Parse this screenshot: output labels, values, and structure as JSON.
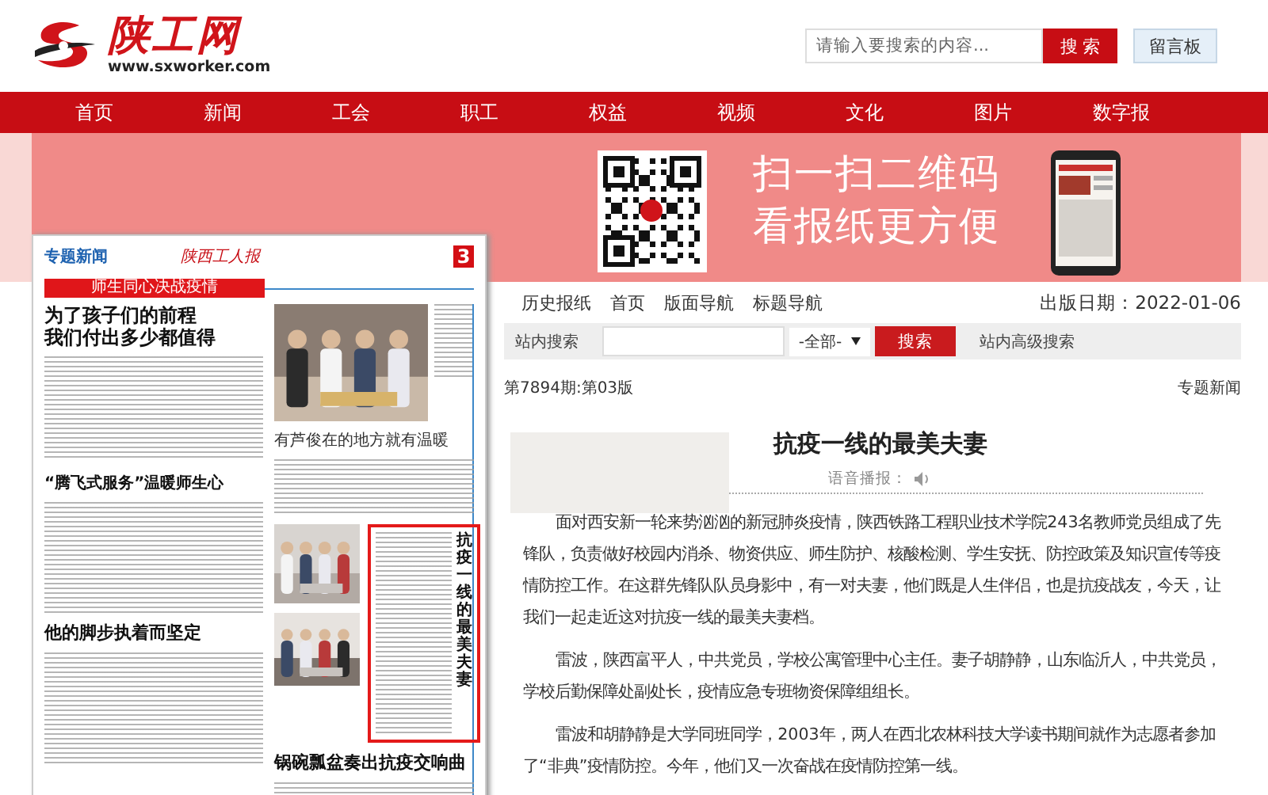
{
  "header": {
    "logo": {
      "name": "陕工网",
      "url": "www.sxworker.com"
    },
    "search": {
      "placeholder": "请输入要搜索的内容...",
      "button": "搜 索"
    },
    "guestbook": "留言板"
  },
  "nav": [
    {
      "label": "首页"
    },
    {
      "label": "新闻"
    },
    {
      "label": "工会"
    },
    {
      "label": "职工"
    },
    {
      "label": "权益"
    },
    {
      "label": "视频"
    },
    {
      "label": "文化"
    },
    {
      "label": "图片"
    },
    {
      "label": "数字报"
    }
  ],
  "banner": {
    "lines": [
      "扫一扫二维码",
      "看报纸更方便"
    ]
  },
  "newspaper_page": {
    "section": "专题新闻",
    "masthead": "陕西工人报",
    "page_number": "3",
    "feature_label": "师生同心决战疫情",
    "lead": {
      "lines": [
        "为了孩子们的前程",
        "我们付出多少都值得"
      ]
    },
    "left_stories": [
      {
        "title": "“腾飞式服务”温暖师生心"
      },
      {
        "title": "他的脚步执着而坚定"
      }
    ],
    "right_story": {
      "title": "有芦俊在的地方就有温暖"
    },
    "boxed_story": {
      "title": "抗疫一线的最美夫妻"
    },
    "bottom_story": {
      "title": "锅碗瓢盆奏出抗疫交响曲"
    }
  },
  "article": {
    "toolbar": {
      "links": [
        "历史报纸",
        "首页",
        "版面导航",
        "标题导航"
      ],
      "date": "出版日期：2022-01-06"
    },
    "search": {
      "label": "站内搜索",
      "select": "-全部-",
      "button": "搜索",
      "advanced": "站内高级搜索"
    },
    "issue": "第7894期:第03版",
    "section": "专题新闻",
    "title": "抗疫一线的最美夫妻",
    "audio_label": "语音播报：",
    "paragraphs": [
      "面对西安新一轮来势汹汹的新冠肺炎疫情，陕西铁路工程职业技术学院243名教师党员组成了先锋队，负责做好校园内消杀、物资供应、师生防护、核酸检测、学生安抚、防控政策及知识宣传等疫情防控工作。在这群先锋队队员身影中，有一对夫妻，他们既是人生伴侣，也是抗疫战友，今天，让我们一起走近这对抗疫一线的最美夫妻档。",
      "雷波，陕西富平人，中共党员，学校公寓管理中心主任。妻子胡静静，山东临沂人，中共党员，学校后勤保障处副处长，疫情应急专班物资保障组组长。",
      "雷波和胡静静是大学同班同学，2003年，两人在西北农林科技大学读书期间就作为志愿者参加了“非典”疫情防控。今年，他们又一次奋战在疫情防控第一线。"
    ]
  }
}
